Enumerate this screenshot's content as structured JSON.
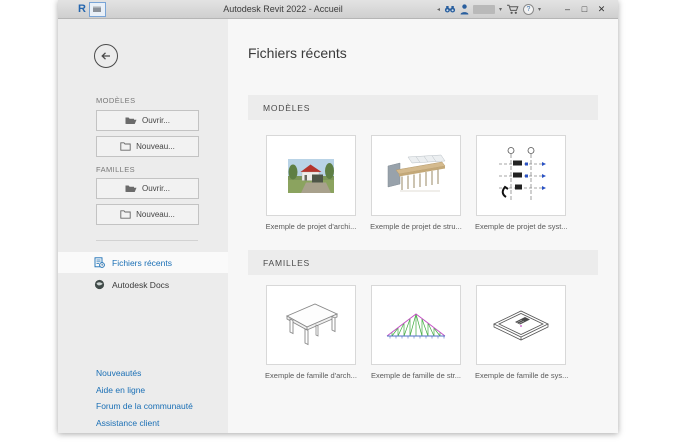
{
  "titlebar": {
    "logo": "R",
    "title": "Autodesk Revit 2022 - Accueil",
    "caret_left": "◂",
    "caret_down": "▾",
    "help_glyph": "?",
    "controls": {
      "minimize": "–",
      "maximize": "□",
      "close": "✕"
    }
  },
  "sidebar": {
    "models": {
      "label": "MODÈLES",
      "open": "Ouvrir...",
      "new": "Nouveau..."
    },
    "families": {
      "label": "FAMILLES",
      "open": "Ouvrir...",
      "new": "Nouveau..."
    },
    "nav": [
      {
        "label": "Fichiers récents"
      },
      {
        "label": "Autodesk Docs"
      }
    ],
    "links": [
      "Nouveautés",
      "Aide en ligne",
      "Forum de la communauté",
      "Assistance client"
    ]
  },
  "main": {
    "title": "Fichiers récents",
    "models_section": {
      "label": "MODÈLES",
      "cards": [
        {
          "caption": "Exemple de projet d'archi..."
        },
        {
          "caption": "Exemple de projet de stru..."
        },
        {
          "caption": "Exemple de projet de syst..."
        }
      ]
    },
    "families_section": {
      "label": "FAMILLES",
      "cards": [
        {
          "caption": "Exemple de famille d'arch..."
        },
        {
          "caption": "Exemple de famille de str..."
        },
        {
          "caption": "Exemple de famille de sys..."
        }
      ]
    }
  },
  "colors": {
    "accent_blue": "#1a6fb5",
    "titlebar_icon_blue": "#2a5f9e"
  }
}
